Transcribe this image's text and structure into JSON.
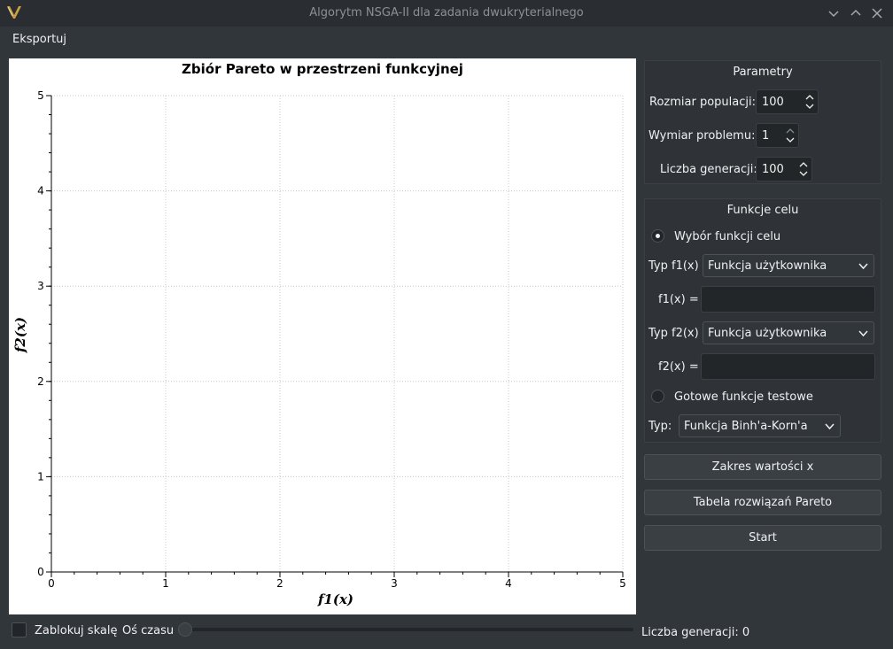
{
  "window": {
    "title": "Algorytm NSGA-II dla zadania dwukryterialnego"
  },
  "menubar": {
    "items": [
      "Eksportuj"
    ]
  },
  "chart_data": {
    "type": "scatter",
    "title": "Zbiór Pareto w przestrzeni funkcyjnej",
    "xlabel": "f1(x)",
    "ylabel": "f2(x)",
    "xlim": [
      0,
      5
    ],
    "ylim": [
      0,
      5
    ],
    "x_ticks": [
      "0",
      "1",
      "2",
      "3",
      "4",
      "5"
    ],
    "y_ticks": [
      "0",
      "1",
      "2",
      "3",
      "4",
      "5"
    ],
    "grid": true,
    "series": [
      {
        "values": []
      }
    ]
  },
  "parametry": {
    "title": "Parametry",
    "population_label": "Rozmiar populacji:",
    "population_value": "100",
    "dimension_label": "Wymiar problemu:",
    "dimension_value": "1",
    "generations_label": "Liczba generacji:",
    "generations_value": "100"
  },
  "funkcje": {
    "title": "Funkcje celu",
    "custom_radio_label": "Wybór funkcji celu",
    "typ_f1_label": "Typ f1(x)",
    "typ_f1_value": "Funkcja użytkownika",
    "f1_label": "f1(x) =",
    "f1_value": "",
    "typ_f2_label": "Typ f2(x)",
    "typ_f2_value": "Funkcja użytkownika",
    "f2_label": "f2(x) =",
    "f2_value": "",
    "test_radio_label": "Gotowe funkcje testowe",
    "typ_label": "Typ:",
    "typ_value": "Funkcja Binh'a-Korn'a"
  },
  "buttons": {
    "range": "Zakres wartości x",
    "pareto_table": "Tabela rozwiązań Pareto",
    "start": "Start"
  },
  "bottom": {
    "lock_scale_label": "Zablokuj skalę",
    "time_axis_label": "Oś czasu",
    "generation_count_label": "Liczba generacji: 0",
    "time_slider_value": 0
  }
}
